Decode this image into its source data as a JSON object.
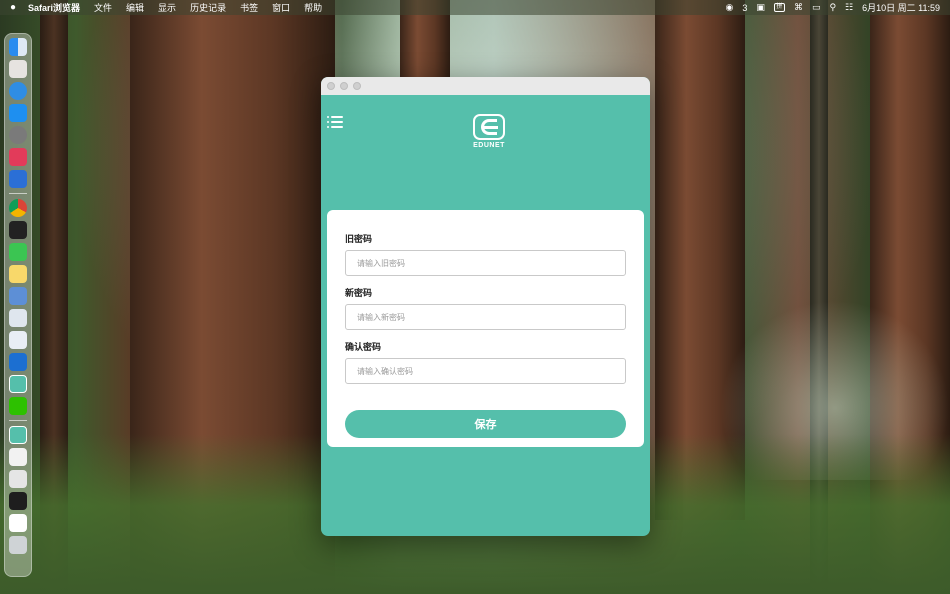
{
  "menubar": {
    "apple_icon": "apple-icon",
    "app_name": "Safari浏览器",
    "items": [
      "文件",
      "编辑",
      "显示",
      "历史记录",
      "书签",
      "窗口",
      "帮助"
    ],
    "wechat_badge": "3",
    "input_method": "拼",
    "datetime": "6月10日 周二 11:59"
  },
  "dock": {
    "icons": [
      "finder-icon",
      "launchpad-icon",
      "safari-icon",
      "app-store-icon",
      "system-settings-icon",
      "flag-app-icon",
      "xcode-icon",
      "chrome-icon",
      "terminal-icon",
      "messages-icon",
      "notes-icon",
      "preview-icon",
      "screen-app-icon",
      "accessibility-icon",
      "edunet-app-icon",
      "wechat-icon",
      "edunet-app-icon",
      "file-icon",
      "file-icon",
      "screenshot-icon",
      "folder-icon",
      "trash-icon"
    ]
  },
  "app": {
    "logo_text": "EDUNET",
    "form": {
      "old_password_label": "旧密码",
      "old_password_placeholder": "请输入旧密码",
      "new_password_label": "新密码",
      "new_password_placeholder": "请输入新密码",
      "confirm_password_label": "确认密码",
      "confirm_password_placeholder": "请输入确认密码",
      "save_label": "保存"
    }
  },
  "colors": {
    "accent": "#55bfab",
    "card_bg": "#ffffff"
  }
}
